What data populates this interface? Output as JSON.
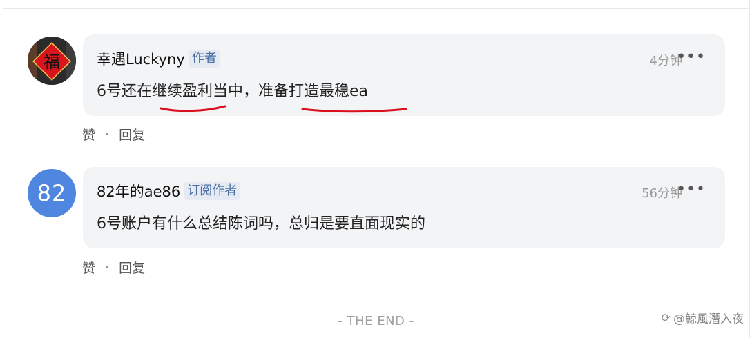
{
  "comments": [
    {
      "username": "幸遇Luckyny",
      "badge": "作者",
      "time": "4分钟",
      "more": "•••",
      "text": "6号还在继续盈利当中，准备打造最稳ea",
      "avatar_glyph": "福",
      "actions": {
        "like": "赞",
        "sep": "·",
        "reply": "回复"
      }
    },
    {
      "username": "82年的ae86",
      "badge": "订阅作者",
      "time": "56分钟",
      "more": "•••",
      "text": "6号账户有什么总结陈词吗，总归是要直面现实的",
      "avatar_initials": "82",
      "actions": {
        "like": "赞",
        "sep": "·",
        "reply": "回复"
      }
    }
  ],
  "footer": {
    "end_text": "- THE END -"
  },
  "watermark": {
    "text": "@鯨風潛入夜"
  },
  "colors": {
    "bubble": "#f3f4f6",
    "avatar_blue": "#4f86e0",
    "badge_text": "#4a6fa5",
    "badge_bg": "#e6ebf3",
    "underline": "#d9111f"
  }
}
